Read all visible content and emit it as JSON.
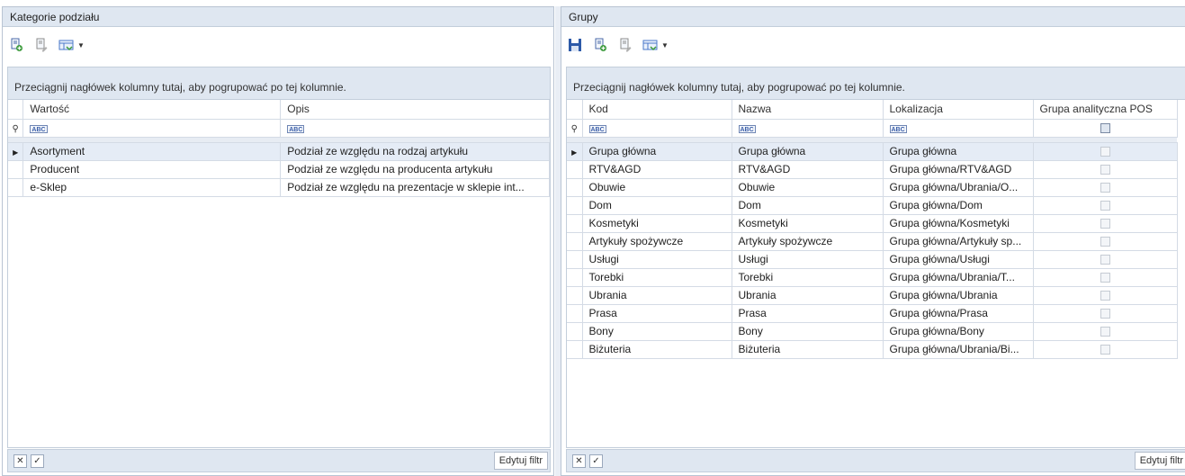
{
  "left": {
    "title": "Kategorie podziału",
    "group_hint": "Przeciągnij nagłówek kolumny tutaj, aby pogrupować po tej kolumnie.",
    "columns": [
      "Wartość",
      "Opis"
    ],
    "rows": [
      [
        "Asortyment",
        "Podział ze względu na rodzaj artykułu"
      ],
      [
        "Producent",
        "Podział ze względu na producenta artykułu"
      ],
      [
        "e-Sklep",
        "Podział ze względu na prezentacje w sklepie int..."
      ]
    ],
    "edit_filter_label": "Edytuj filtr"
  },
  "right": {
    "title": "Grupy",
    "group_hint": "Przeciągnij nagłówek kolumny tutaj, aby pogrupować po tej kolumnie.",
    "columns": [
      "Kod",
      "Nazwa",
      "Lokalizacja",
      "Grupa analityczna POS"
    ],
    "rows": [
      [
        "Grupa główna",
        "Grupa główna",
        "Grupa główna"
      ],
      [
        "RTV&AGD",
        "RTV&AGD",
        "Grupa główna/RTV&AGD"
      ],
      [
        "Obuwie",
        "Obuwie",
        "Grupa główna/Ubrania/O..."
      ],
      [
        "Dom",
        "Dom",
        "Grupa główna/Dom"
      ],
      [
        "Kosmetyki",
        "Kosmetyki",
        "Grupa główna/Kosmetyki"
      ],
      [
        "Artykuły spożywcze",
        "Artykuły spożywcze",
        "Grupa główna/Artykuły sp..."
      ],
      [
        "Usługi",
        "Usługi",
        "Grupa główna/Usługi"
      ],
      [
        "Torebki",
        "Torebki",
        "Grupa główna/Ubrania/T..."
      ],
      [
        "Ubrania",
        "Ubrania",
        "Grupa główna/Ubrania"
      ],
      [
        "Prasa",
        "Prasa",
        "Grupa główna/Prasa"
      ],
      [
        "Bony",
        "Bony",
        "Grupa główna/Bony"
      ],
      [
        "Biżuteria",
        "Biżuteria",
        "Grupa główna/Ubrania/Bi..."
      ]
    ],
    "edit_filter_label": "Edytuj filtr"
  },
  "filter_text_icon": "abc-filter-icon",
  "colors": {
    "header_bg": "#dfe7f1",
    "border": "#c3cedb",
    "focused_row": "#e5ecf6",
    "icon_blue": "#3a5ea8"
  }
}
